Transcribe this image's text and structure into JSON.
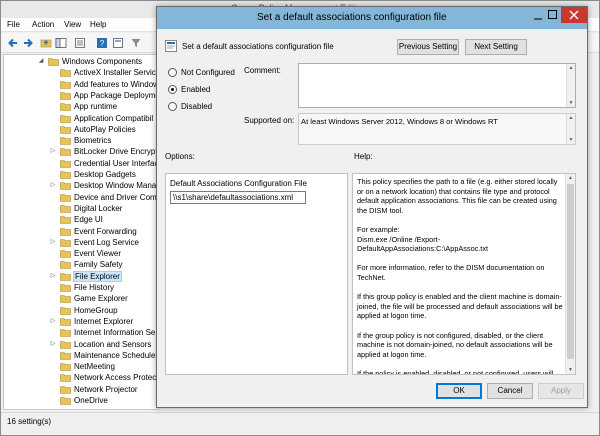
{
  "background_window": {
    "title": "Group Policy Management Editor",
    "menu": [
      "File",
      "Action",
      "View",
      "Help"
    ],
    "tree_items": [
      {
        "label": "Windows Components",
        "expanded": true
      },
      {
        "label": "ActiveX Installer Service"
      },
      {
        "label": "Add features to Windows"
      },
      {
        "label": "App Package Deployme"
      },
      {
        "label": "App runtime"
      },
      {
        "label": "Application Compatibil"
      },
      {
        "label": "AutoPlay Policies"
      },
      {
        "label": "Biometrics"
      },
      {
        "label": "BitLocker Drive Encrypti",
        "expandable": true
      },
      {
        "label": "Credential User Interfac"
      },
      {
        "label": "Desktop Gadgets"
      },
      {
        "label": "Desktop Window Mana",
        "expandable": true
      },
      {
        "label": "Device and Driver Comp"
      },
      {
        "label": "Digital Locker"
      },
      {
        "label": "Edge UI"
      },
      {
        "label": "Event Forwarding"
      },
      {
        "label": "Event Log Service",
        "expandable": true
      },
      {
        "label": "Event Viewer"
      },
      {
        "label": "Family Safety"
      },
      {
        "label": "File Explorer",
        "expandable": true,
        "selected": true
      },
      {
        "label": "File History"
      },
      {
        "label": "Game Explorer"
      },
      {
        "label": "HomeGroup"
      },
      {
        "label": "Internet Explorer",
        "expandable": true
      },
      {
        "label": "Internet Information Se"
      },
      {
        "label": "Location and Sensors",
        "expandable": true
      },
      {
        "label": "Maintenance Scheduler"
      },
      {
        "label": "NetMeeting"
      },
      {
        "label": "Network Access Protect"
      },
      {
        "label": "Network Projector"
      },
      {
        "label": "OneDrive"
      }
    ],
    "status": "16 setting(s)"
  },
  "dialog": {
    "title": "Set a default associations configuration file",
    "setting_name": "Set a default associations configuration file",
    "previous_button": "Previous Setting",
    "next_button": "Next Setting",
    "radio_options": [
      {
        "label": "Not Configured",
        "checked": false
      },
      {
        "label": "Enabled",
        "checked": true
      },
      {
        "label": "Disabled",
        "checked": false
      }
    ],
    "comment_label": "Comment:",
    "comment_value": "",
    "supported_label": "Supported on:",
    "supported_value": "At least Windows Server 2012, Windows 8 or Windows RT",
    "options_label": "Options:",
    "help_label": "Help:",
    "option_field_label": "Default Associations Configuration File",
    "option_field_value": "\\\\s1\\share\\defaultassociations.xml",
    "help_paragraphs": [
      "This policy specifies the path to a file (e.g. either stored locally or on a network location) that contains file type and protocol default application associations. This file can be created using the DISM tool.",
      "For example:\nDism.exe /Online /Export-DefaultAppAssociations:C:\\AppAssoc.txt",
      "For more information, refer to the DISM documentation on TechNet.",
      "If this group policy is enabled and the client machine is domain-joined, the file will be processed and default associations will be applied at logon time.",
      "If the group policy is not configured, disabled, or the client machine is not domain-joined, no default associations will be applied at logon time.",
      "If the policy is enabled, disabled, or not configured, users will still"
    ],
    "ok_button": "OK",
    "cancel_button": "Cancel",
    "apply_button": "Apply"
  },
  "colors": {
    "dialog_titlebar": "#83b6d7",
    "close_button": "#c7392f",
    "selection": "#cce8ff",
    "folder": "#e8c35a"
  }
}
